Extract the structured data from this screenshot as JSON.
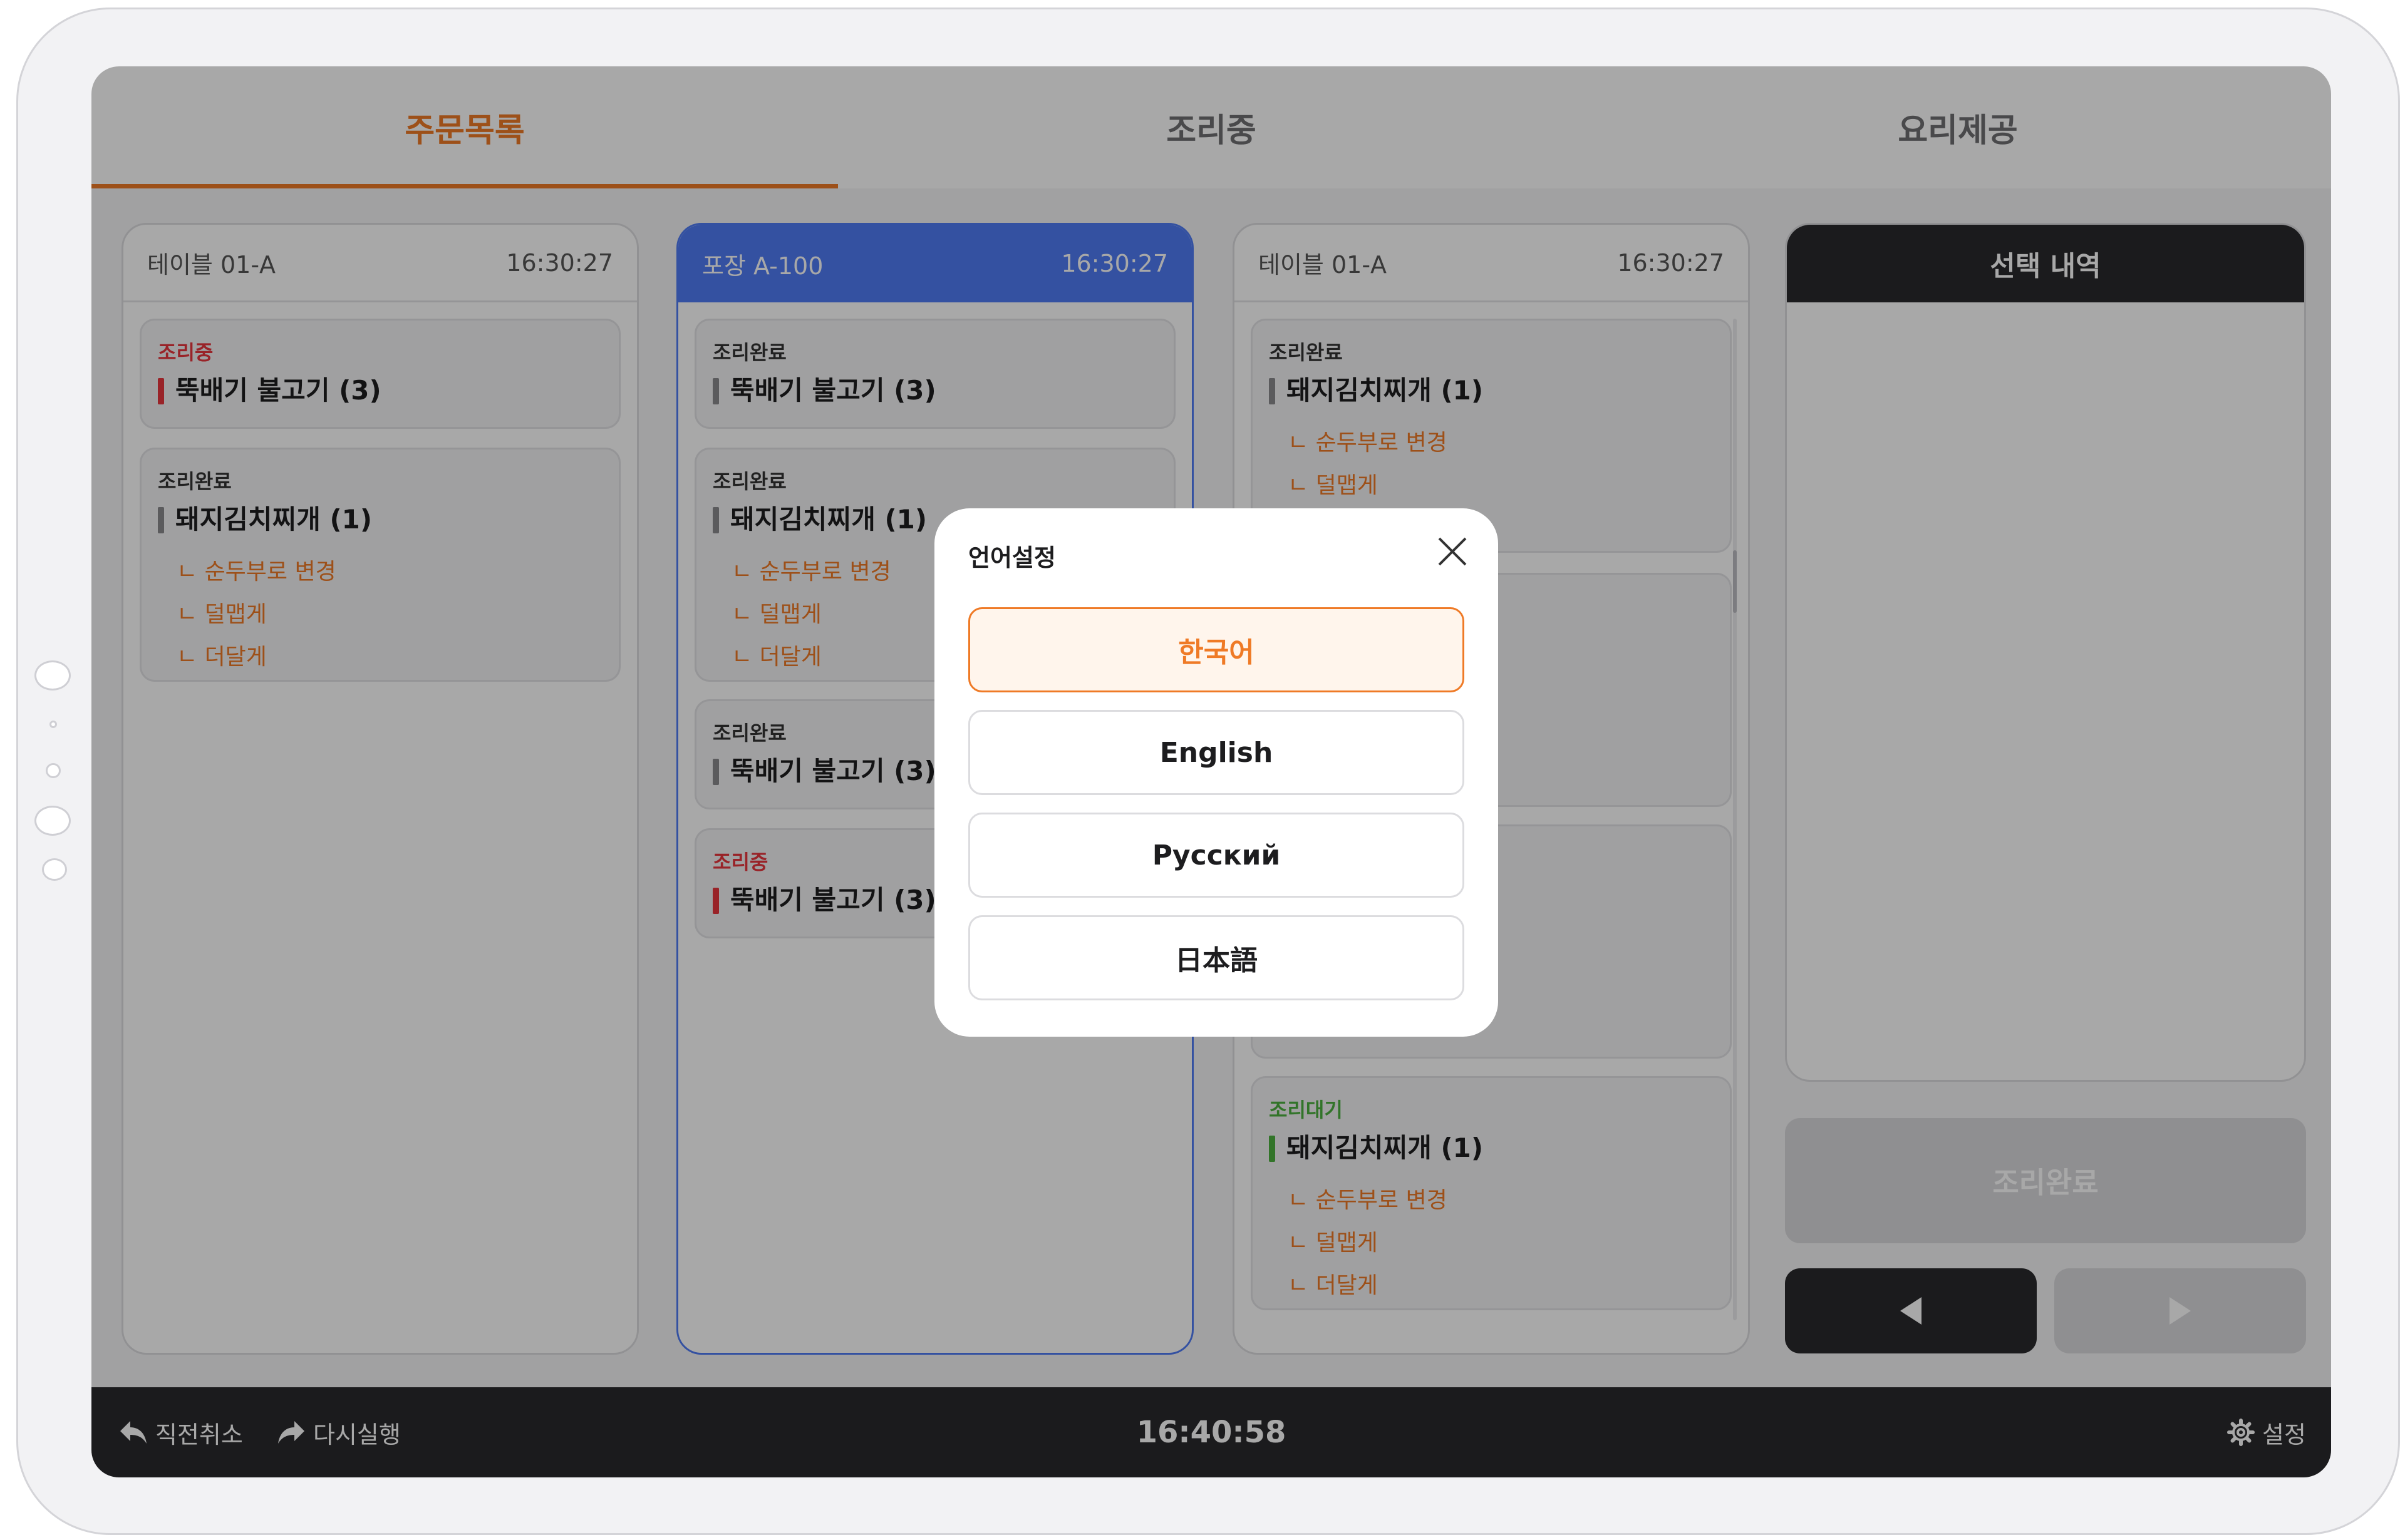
{
  "tabs": [
    "주문목록",
    "조리중",
    "요리제공"
  ],
  "orders": [
    {
      "name": "테이블 01-A",
      "time": "16:30:27",
      "items": [
        {
          "status": "조리중",
          "dish": "뚝배기 불고기 (3)",
          "options": []
        },
        {
          "status": "조리완료",
          "dish": "돼지김치찌개 (1)",
          "options": [
            "ㄴ 순두부로 변경",
            "ㄴ 덜맵게",
            "ㄴ 더달게"
          ]
        }
      ]
    },
    {
      "name": "포장 A-100",
      "time": "16:30:27",
      "items": [
        {
          "status": "조리완료",
          "dish": "뚝배기 불고기 (3)",
          "options": []
        },
        {
          "status": "조리완료",
          "dish": "돼지김치찌개 (1)",
          "options": [
            "ㄴ 순두부로 변경",
            "ㄴ 덜맵게",
            "ㄴ 더달게"
          ]
        },
        {
          "status": "조리완료",
          "dish": "뚝배기 불고기 (3)",
          "options": []
        },
        {
          "status": "조리중",
          "dish": "뚝배기 불고기 (3)",
          "options": []
        }
      ]
    },
    {
      "name": "테이블 01-A",
      "time": "16:30:27",
      "items": [
        {
          "status": "조리완료",
          "dish": "돼지김치찌개 (1)",
          "options": [
            "ㄴ 순두부로 변경",
            "ㄴ 덜맵게"
          ]
        },
        {
          "status": "조리대기",
          "dish": "돼지김치찌개 (1)",
          "options": [
            "ㄴ 순두부로 변경",
            "ㄴ 덜맵게",
            "ㄴ 더달게"
          ]
        }
      ]
    }
  ],
  "selection": {
    "title": "선택 내역",
    "complete_label": "조리완료"
  },
  "bottom": {
    "undo": "직전취소",
    "redo": "다시실행",
    "clock": "16:40:58",
    "settings": "설정"
  },
  "modal": {
    "title": "언어설정",
    "languages": [
      "한국어",
      "English",
      "Русский",
      "日本語"
    ],
    "selected": "한국어"
  },
  "colors": {
    "accent": "#ef7a26",
    "blue": "#4f7cf4",
    "cooking": "#e8363d",
    "waiting": "#4cb03f",
    "dark": "#2a2a2c"
  }
}
